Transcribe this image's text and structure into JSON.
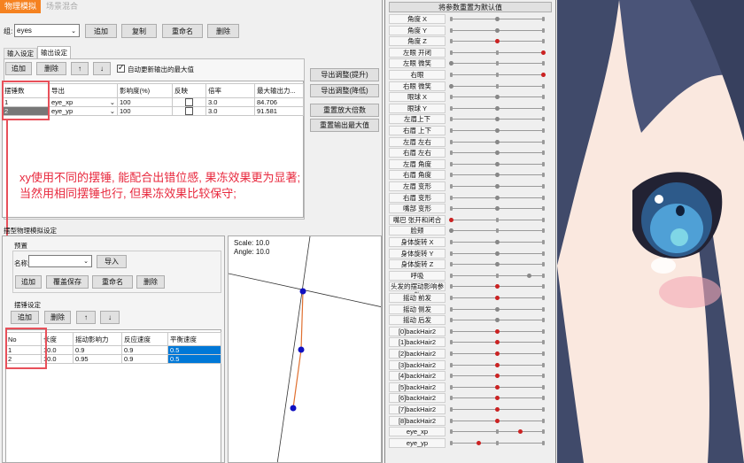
{
  "tabs": {
    "physics": "物理模拟",
    "scene_mix": "场景混合"
  },
  "group": {
    "label": "组:",
    "value": "eyes",
    "add": "追加",
    "copy": "复制",
    "rename": "重命名",
    "delete": "删除"
  },
  "subtabs": {
    "input": "输入设定",
    "output": "输出设定"
  },
  "output_toolbar": {
    "add": "追加",
    "delete": "删除",
    "up": "↑",
    "down": "↓",
    "auto_update": "自动更新输出的最大值"
  },
  "output_table": {
    "headers": [
      "摆锤数",
      "导出",
      "影响度(%)",
      "反映",
      "倍率",
      "最大输出力..."
    ],
    "rows": [
      {
        "index": "1",
        "param": "eye_xp",
        "influence": "100",
        "rate": "3.0",
        "max": "84.706"
      },
      {
        "index": "2",
        "param": "eye_yp",
        "influence": "100",
        "rate": "3.0",
        "max": "91.581"
      }
    ]
  },
  "right_buttons": {
    "export_up": "导出调整(提升)",
    "export_down": "导出调整(降低)",
    "reset_scale": "重置放大倍数",
    "reset_max": "重置输出最大值"
  },
  "annotation": {
    "line1": "xy使用不同的摆锤, 能配合出错位感, 果冻效果更为显著;",
    "line2": "当然用相同摆锤也行, 但果冻效果比较保守;"
  },
  "pendulum_section": {
    "title": "摆型物理模拟设定",
    "preset_label": "预置",
    "name_label": "名称:",
    "import": "导入",
    "add": "追加",
    "overwrite": "覆盖保存",
    "rename": "重命名",
    "delete": "删除"
  },
  "pendulum_settings": {
    "title": "摆锤设定",
    "add": "追加",
    "delete": "删除",
    "up": "↑",
    "down": "↓",
    "headers": [
      "No",
      "长度",
      "摇动影响力",
      "反应速度",
      "平衡速度"
    ],
    "rows": [
      {
        "no": "1",
        "len": "10.0",
        "shake": "0.9",
        "react": "0.9",
        "balance": "0.5"
      },
      {
        "no": "2",
        "len": "10.0",
        "shake": "0.95",
        "react": "0.9",
        "balance": "0.5"
      }
    ]
  },
  "preview": {
    "scale": "Scale: 10.0",
    "angle": "Angle: 10.0"
  },
  "params_panel": {
    "reset_button": "将参数重置为默认值",
    "items": [
      {
        "label": "角度 X",
        "knob": 0.5,
        "red": false
      },
      {
        "label": "角度 Y",
        "knob": 0.5,
        "red": false
      },
      {
        "label": "角度 Z",
        "knob": 0.5,
        "red": true
      },
      {
        "label": "左眼 开闭",
        "knob": 1.0,
        "red": true
      },
      {
        "label": "左眼 微笑",
        "knob": 0.0,
        "red": false
      },
      {
        "label": "右眼",
        "knob": 1.0,
        "red": true
      },
      {
        "label": "右眼 微笑",
        "knob": 0.0,
        "red": false
      },
      {
        "label": "眼球 X",
        "knob": 0.5,
        "red": false
      },
      {
        "label": "眼球 Y",
        "knob": 0.5,
        "red": false
      },
      {
        "label": "左眉上下",
        "knob": 0.5,
        "red": false
      },
      {
        "label": "右眉 上下",
        "knob": 0.5,
        "red": false
      },
      {
        "label": "左眉 左右",
        "knob": 0.5,
        "red": false
      },
      {
        "label": "右眉 左右",
        "knob": 0.5,
        "red": false
      },
      {
        "label": "左眉 角度",
        "knob": 0.5,
        "red": false
      },
      {
        "label": "右眉 角度",
        "knob": 0.5,
        "red": false
      },
      {
        "label": "左眉 变形",
        "knob": 0.5,
        "red": false
      },
      {
        "label": "右眉 变形",
        "knob": 0.5,
        "red": false
      },
      {
        "label": "嘴部 变形",
        "knob": 0.5,
        "red": false
      },
      {
        "label": "嘴巴 张开和闭合",
        "knob": 0.0,
        "red": true
      },
      {
        "label": "脸颊",
        "knob": 0.0,
        "red": false
      },
      {
        "label": "身体旋转 X",
        "knob": 0.5,
        "red": false
      },
      {
        "label": "身体旋转 Y",
        "knob": 0.5,
        "red": false
      },
      {
        "label": "身体旋转 Z",
        "knob": 0.5,
        "red": false
      },
      {
        "label": "呼吸",
        "knob": 0.85,
        "red": false
      },
      {
        "label": "头发的摆动影响参数",
        "knob": 0.5,
        "red": true
      },
      {
        "label": "摇动 前发",
        "knob": 0.5,
        "red": true
      },
      {
        "label": "摇动 侧发",
        "knob": 0.5,
        "red": false
      },
      {
        "label": "摇动 后发",
        "knob": 0.5,
        "red": false
      },
      {
        "label": "[0]backHair2",
        "knob": 0.5,
        "red": true
      },
      {
        "label": "[1]backHair2",
        "knob": 0.5,
        "red": true
      },
      {
        "label": "[2]backHair2",
        "knob": 0.5,
        "red": true
      },
      {
        "label": "[3]backHair2",
        "knob": 0.5,
        "red": true
      },
      {
        "label": "[4]backHair2",
        "knob": 0.5,
        "red": true
      },
      {
        "label": "[5]backHair2",
        "knob": 0.5,
        "red": true
      },
      {
        "label": "[6]backHair2",
        "knob": 0.5,
        "red": true
      },
      {
        "label": "[7]backHair2",
        "knob": 0.5,
        "red": true
      },
      {
        "label": "[8]backHair2",
        "knob": 0.5,
        "red": true
      },
      {
        "label": "eye_xp",
        "knob": 0.75,
        "red": true
      },
      {
        "label": "eye_yp",
        "knob": 0.3,
        "red": true
      }
    ]
  },
  "colors": {
    "red_annotation": "#e8293e",
    "selection_blue": "#0078d7",
    "tab_active": "#f58220"
  }
}
